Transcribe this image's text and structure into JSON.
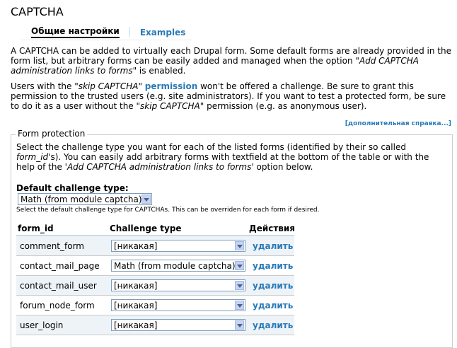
{
  "page": {
    "title": "CAPTCHA"
  },
  "tabs": [
    {
      "label": "Общие настройки",
      "active": true
    },
    {
      "label": "Examples",
      "active": false
    }
  ],
  "intro": {
    "p1_a": "A CAPTCHA can be added to virtually each Drupal form. Some default forms are already provided in the form list, but arbitrary forms can be easily added and managed when the option \"",
    "p1_em": "Add CAPTCHA administration links to forms",
    "p1_b": "\" is enabled.",
    "p2_a": "Users with the \"",
    "p2_em1": "skip CAPTCHA",
    "p2_b": "\" ",
    "p2_link": "permission",
    "p2_c": " won't be offered a challenge. Be sure to grant this permission to the trusted users (e.g. site administrators). If you want to test a protected form, be sure to do it as a user without the \"",
    "p2_em2": "skip CAPTCHA",
    "p2_d": "\" permission (e.g. as anonymous user)."
  },
  "help_link": "[дополнительная справка...]",
  "fieldset": {
    "legend": "Form protection",
    "desc_a": "Select the challenge type you want for each of the listed forms (identified by their so called ",
    "desc_em1": "form_id",
    "desc_b": "'s). You can easily add arbitrary forms with textfield at the bottom of the table or with the help of the '",
    "desc_em2": "Add CAPTCHA administration links to forms",
    "desc_c": "' option below.",
    "default_label": "Default challenge type:",
    "default_value": "Math (from module captcha)",
    "default_desc": "Select the default challenge type for CAPTCHAs. This can be overriden for each form if desired."
  },
  "table": {
    "headers": {
      "form_id": "form_id",
      "challenge": "Challenge type",
      "actions": "Действия"
    },
    "rows": [
      {
        "form_id": "comment_form",
        "challenge": "[никакая]",
        "action": "удалить"
      },
      {
        "form_id": "contact_mail_page",
        "challenge": "Math (from module captcha)",
        "action": "удалить"
      },
      {
        "form_id": "contact_mail_user",
        "challenge": "[никакая]",
        "action": "удалить"
      },
      {
        "form_id": "forum_node_form",
        "challenge": "[никакая]",
        "action": "удалить"
      },
      {
        "form_id": "user_login",
        "challenge": "[никакая]",
        "action": "удалить"
      }
    ]
  },
  "colors": {
    "link": "#2a7ab8",
    "row_alt": "#eef3f8"
  }
}
